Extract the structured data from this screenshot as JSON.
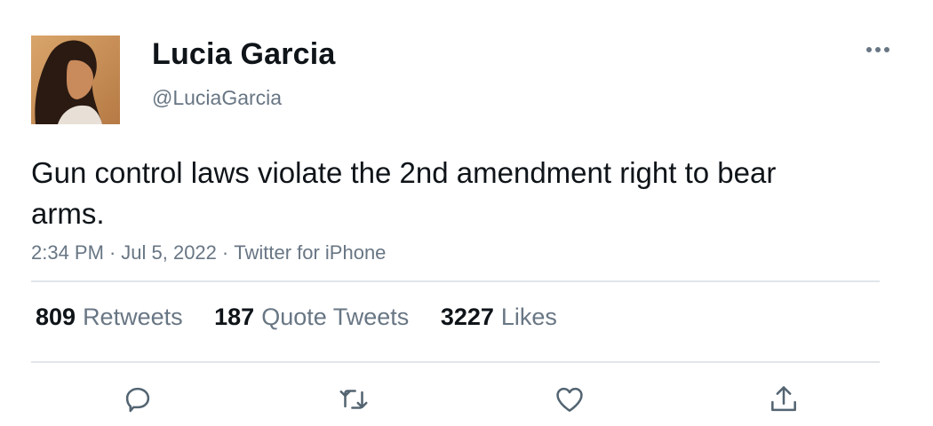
{
  "author": {
    "name": "Lucia Garcia",
    "handle": "@LuciaGarcia"
  },
  "tweet": {
    "text": "Gun control laws violate the 2nd amendment right to bear arms.",
    "time": "2:34 PM",
    "date": "Jul 5, 2022",
    "source": "Twitter for iPhone",
    "separator": "·"
  },
  "stats": {
    "retweets": {
      "count": "809",
      "label": "Retweets"
    },
    "quote_tweets": {
      "count": "187",
      "label": "Quote Tweets"
    },
    "likes": {
      "count": "3227",
      "label": "Likes"
    }
  },
  "actions": [
    "reply-icon",
    "retweet-icon",
    "like-icon",
    "share-icon"
  ],
  "colors": {
    "text": "#0f1419",
    "secondary": "#687684",
    "divider": "#e1e6ea"
  }
}
